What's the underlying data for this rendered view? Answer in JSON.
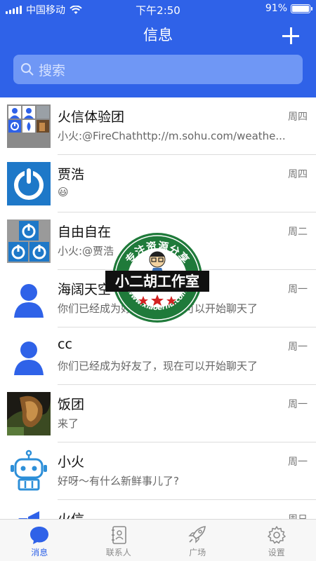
{
  "status_bar": {
    "carrier": "中国移动",
    "time": "下午2:50",
    "battery": "91%",
    "battery_level": 0.91
  },
  "header": {
    "title": "信息",
    "add_icon": "plus-icon"
  },
  "search": {
    "placeholder": "搜索",
    "icon": "search-icon"
  },
  "conversations": [
    {
      "name": "火信体验团",
      "preview": "小火:@FireChathttp://m.sohu.com/weathe...",
      "day": "周四",
      "avatar": "group-avatar"
    },
    {
      "name": "贾浩",
      "preview": "😃",
      "day": "周四",
      "avatar": "power-avatar"
    },
    {
      "name": "自由自在",
      "preview": "小火:@贾浩",
      "day": "周二",
      "avatar": "group-power-avatar"
    },
    {
      "name": "海阔天空",
      "preview": "你们已经成为好友了，现在可以开始聊天了",
      "day": "周一",
      "avatar": "person-avatar"
    },
    {
      "name": "cc",
      "preview": "你们已经成为好友了，现在可以开始聊天了",
      "day": "周一",
      "avatar": "person-avatar"
    },
    {
      "name": "饭团",
      "preview": "来了",
      "day": "周一",
      "avatar": "photo-avatar"
    },
    {
      "name": "小火",
      "preview": "好呀～有什么新鲜事儿了?",
      "day": "周一",
      "avatar": "robot-avatar"
    },
    {
      "name": "火信",
      "preview": "",
      "day": "周日",
      "avatar": "megaphone-avatar"
    }
  ],
  "watermark": {
    "top_text": "专注资源分享",
    "banner": "小二胡工作室",
    "bottom_text": "www.xiaoerhu.com"
  },
  "tabs": [
    {
      "label": "消息",
      "icon": "chat-bubble-icon",
      "active": true
    },
    {
      "label": "联系人",
      "icon": "contacts-book-icon",
      "active": false
    },
    {
      "label": "广场",
      "icon": "rocket-icon",
      "active": false
    },
    {
      "label": "设置",
      "icon": "gear-icon",
      "active": false
    }
  ],
  "colors": {
    "brand": "#2f62e8",
    "search_bg": "#6f97f5",
    "tab_inactive": "#8a8a8a"
  }
}
